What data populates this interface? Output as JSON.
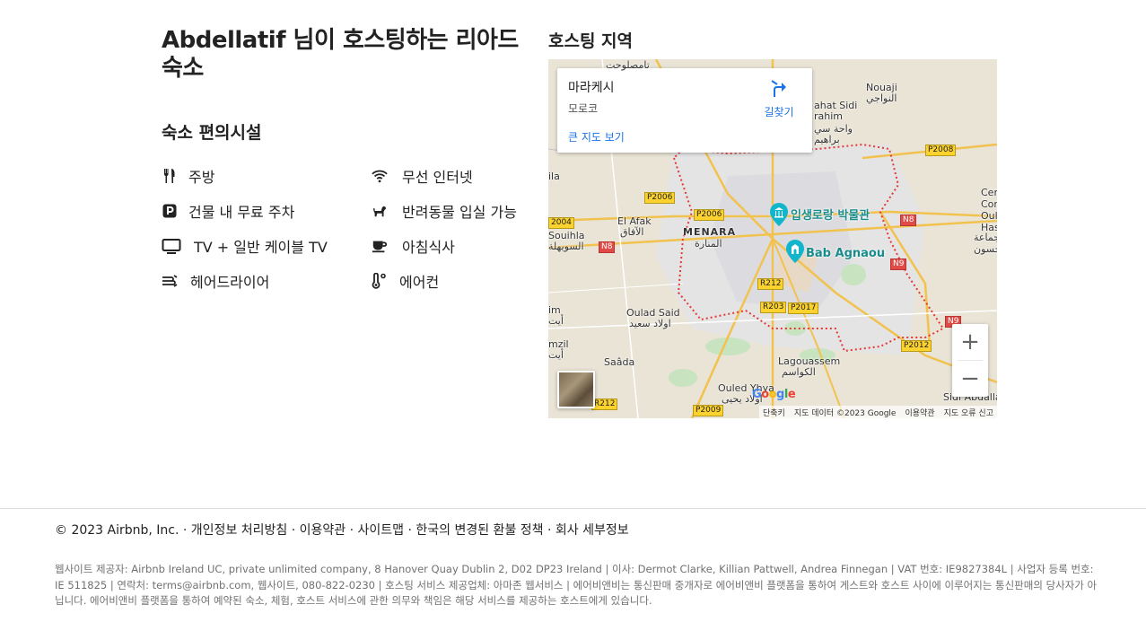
{
  "listing": {
    "title": "Abdellatif 님이 호스팅하는 리아드 숙소",
    "amenities_title": "숙소 편의시설",
    "amenities": [
      {
        "icon": "fork-knife-icon",
        "label": "주방"
      },
      {
        "icon": "wifi-icon",
        "label": "무선 인터넷"
      },
      {
        "icon": "parking-icon",
        "label": "건물 내 무료 주차"
      },
      {
        "icon": "pet-icon",
        "label": "반려동물 입실 가능"
      },
      {
        "icon": "tv-icon",
        "label": "TV + 일반 케이블 TV"
      },
      {
        "icon": "coffee-icon",
        "label": "아침식사"
      },
      {
        "icon": "hair-dryer-icon",
        "label": "헤어드라이어"
      },
      {
        "icon": "thermometer-icon",
        "label": "에어컨"
      }
    ]
  },
  "map": {
    "title": "호스팅 지역",
    "info_city": "마라케시",
    "info_country": "모로코",
    "info_big_map": "큰 지도 보기",
    "info_directions": "길찾기",
    "pin_museum": "입생로랑 박물관",
    "pin_gate": "Bab Agnaou",
    "labels": {
      "menara_fr": "MENARA",
      "menara_ar": "المنارة",
      "el_afak": "El Afak",
      "el_afak_ar": "الآفاق",
      "souihla": "Souihla",
      "souihla_ar": "السويهلة",
      "oulad_said": "Oulad Said",
      "oulad_said_ar": "اولاد سعيد",
      "saada": "Saâda",
      "lagouassem": "Lagouassem",
      "lagouassem_ar": "الكواسم",
      "ouled_yhya": "Ouled Yhya",
      "ouled_yhya_ar": "اولاد يحيى",
      "nouaji": "Nouaji",
      "nouaji_ar": "النواجي",
      "sidi_brahim": "ahat Sidi\nrahim",
      "sidi_brahim_ar": "واحة سي\nبراهيم",
      "tamsloht": "تامصلوحت",
      "cen": "Cen\nComm\nOul\nHass",
      "cen_ar": "جماعة\nحسون",
      "sidi_ab": "Sidi Abdalla",
      "ila": "ila",
      "im": "im\nأيت",
      "mzil": "mzil\nأيت"
    },
    "roads": [
      "P2008",
      "P2006",
      "P2006",
      "N8",
      "N8",
      "N9",
      "N9",
      "R212",
      "R203",
      "P2017",
      "P2012",
      "P2009",
      "R212",
      "2004"
    ],
    "zoom_in": "+",
    "zoom_out": "−",
    "google": "Google",
    "footer": [
      "단축키",
      "지도 데이터 ©2023 Google",
      "이용약관",
      "지도 오류 신고"
    ]
  },
  "footer": {
    "links": "© 2023 Airbnb, Inc. · 개인정보 처리방침 · 이용약관 · 사이트맵 · 한국의 변경된 환불 정책 · 회사 세부정보",
    "legal": "웹사이트 제공자: Airbnb Ireland UC, private unlimited company, 8 Hanover Quay Dublin 2, D02 DP23 Ireland | 이사: Dermot Clarke, Killian Pattwell, Andrea Finnegan | VAT 번호: IE9827384L | 사업자 등록 번호: IE 511825 | 연락처: terms@airbnb.com, 웹사이트, 080-822-0230 | 호스팅 서비스 제공업체: 아마존 웹서비스 | 에어비앤비는 통신판매 중개자로 에어비앤비 플랫폼을 통하여 게스트와 호스트 사이에 이루어지는 통신판매의 당사자가 아닙니다. 에어비앤비 플랫폼을 통하여 예약된 숙소, 체험, 호스트 서비스에 관한 의무와 책임은 해당 서비스를 제공하는 호스트에게 있습니다."
  }
}
